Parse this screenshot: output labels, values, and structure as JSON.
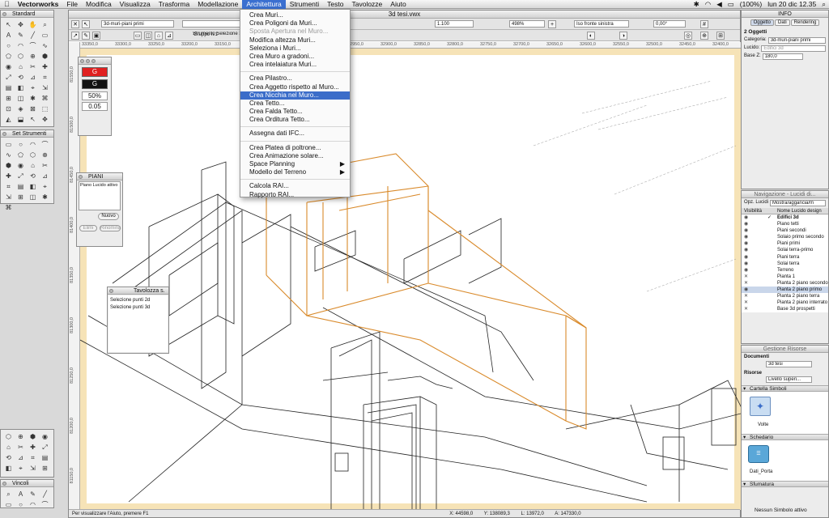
{
  "menubar": {
    "app": "Vectorworks",
    "items": [
      "File",
      "Modifica",
      "Visualizza",
      "Trasforma",
      "Modellazione",
      "Architettura",
      "Strumenti",
      "Testo",
      "Tavolozze",
      "Aiuto"
    ],
    "battery": "(100%)",
    "clock": "lun 20 dic  12.35"
  },
  "document": {
    "title": "3d tesi.vwx",
    "class_field": "3d-muri-piani primi",
    "layer_field": "Gruppo n.1",
    "scale_field": "1.100",
    "zoom_field": "498%",
    "view_field": "Iso fronte sinistra",
    "angle_field": "0,00°",
    "tool_hint": "Strumento Selezione 3D",
    "ruler_ticks": [
      "33350,0",
      "33300,0",
      "33250,0",
      "33200,0",
      "33150,0",
      "33100,0",
      "33050,0",
      "33000,0",
      "32950,0",
      "32900,0",
      "32850,0",
      "32800,0",
      "32750,0",
      "32700,0",
      "32650,0",
      "32600,0",
      "32550,0",
      "32500,0",
      "32450,0",
      "32400,0"
    ],
    "vruler_ticks": [
      "81550,0",
      "81500,0",
      "81450,0",
      "81400,0",
      "81350,0",
      "81300,0",
      "81250,0",
      "81200,0",
      "81150,0"
    ],
    "status": {
      "hint": "Per visualizzare l'Aiuto, premere F1",
      "x": "X: 44598,0",
      "y": "Y: 138089,3",
      "l": "L: 13972,0",
      "a": "A: 147330,0"
    }
  },
  "architettura_menu": {
    "items": [
      {
        "label": "Crea Muri...",
        "state": "normal"
      },
      {
        "label": "Crea Poligoni da Muri...",
        "state": "normal"
      },
      {
        "label": "Sposta Apertura nel Muro...",
        "state": "disabled"
      },
      {
        "label": "Modifica altezza Muri...",
        "state": "normal"
      },
      {
        "label": "Seleziona i Muri...",
        "state": "normal"
      },
      {
        "label": "Crea Muro a gradoni...",
        "state": "normal"
      },
      {
        "label": "Crea intelaiatura Muri...",
        "state": "normal"
      },
      {
        "sep": true
      },
      {
        "label": "Crea Pilastro...",
        "state": "normal"
      },
      {
        "label": "Crea Aggetto rispetto al Muro...",
        "state": "normal"
      },
      {
        "label": "Crea Nicchia nel Muro...",
        "state": "highlighted"
      },
      {
        "label": "Crea Tetto...",
        "state": "normal"
      },
      {
        "label": "Crea Falda Tetto...",
        "state": "normal"
      },
      {
        "label": "Crea Orditura Tetto...",
        "state": "normal"
      },
      {
        "sep": true
      },
      {
        "label": "Assegna dati IFC...",
        "state": "normal"
      },
      {
        "sep": true
      },
      {
        "label": "Crea Platea di poltrone...",
        "state": "normal"
      },
      {
        "label": "Crea Animazione solare...",
        "state": "normal"
      },
      {
        "label": "Space Planning",
        "state": "submenu"
      },
      {
        "label": "Modello del Terreno",
        "state": "submenu"
      },
      {
        "sep": true
      },
      {
        "label": "Calcola RAI...",
        "state": "normal"
      },
      {
        "label": "Rapporto RAI...",
        "state": "normal"
      }
    ]
  },
  "palettes": {
    "standard": "Standard",
    "set_strumenti": "Set Strumenti",
    "vincoli": "Vincoli",
    "attributes": {
      "opacity": "50%",
      "lineweight": "0.05"
    },
    "piani": {
      "title": "PIANI",
      "active_label": "Piano Lucido attivo",
      "new_button": "Nuovo",
      "btn_a": "Elimi",
      "btn_b": "Rinomina"
    },
    "tavolozza": {
      "title": "Tavolozza s.",
      "items": [
        "Selezione punti 2d",
        "Selezione punti 3d"
      ]
    }
  },
  "info": {
    "title": "INFO",
    "tabs": [
      "Oggetto",
      "Dati",
      "Rendering"
    ],
    "objects": "2 Oggetti",
    "categoria_label": "Categoria:",
    "categoria_value": "3d-muri-piani primi",
    "lucido_label": "Lucido:",
    "lucido_value": "Edifici 3d",
    "base_label": "Base Z:",
    "base_value": "180,0"
  },
  "navigazione": {
    "title": "Navigazione - Lucidi di...",
    "opz_label": "Opz. Lucidi",
    "opz_value": "Mostra/aggancia/m",
    "col_vis": "Visibilità",
    "col_name": "Nome Lucido design",
    "layers": [
      {
        "name": "Edifici 3d",
        "vis": "eye",
        "active": true
      },
      {
        "name": "Piano tetti",
        "vis": "eye",
        "active": false
      },
      {
        "name": "Piani secondi",
        "vis": "eye",
        "active": false
      },
      {
        "name": "Solaio primo secondo",
        "vis": "eye",
        "active": false
      },
      {
        "name": "Piani primi",
        "vis": "eye",
        "active": false
      },
      {
        "name": "Solai terra-primo",
        "vis": "eye",
        "active": false
      },
      {
        "name": "Piani terra",
        "vis": "eye",
        "active": false
      },
      {
        "name": "Solai terra",
        "vis": "eye",
        "active": false
      },
      {
        "name": "Terreno",
        "vis": "eye",
        "active": false
      },
      {
        "name": "Pianta 1",
        "vis": "x",
        "active": false
      },
      {
        "name": "Pianta 2 piano secondo",
        "vis": "x",
        "active": false
      },
      {
        "name": "Pianta 2 piano primo",
        "vis": "eye",
        "active": false,
        "selected": true
      },
      {
        "name": "Pianta 2 piano terra",
        "vis": "x",
        "active": false
      },
      {
        "name": "Pianta 2 piano interrato",
        "vis": "x",
        "active": false
      },
      {
        "name": "Base 3d prospetti",
        "vis": "x",
        "active": false
      }
    ]
  },
  "risorse": {
    "title": "Gestione Risorse",
    "documenti_label": "Documenti",
    "documenti_value": "3d tesi",
    "risorse_label": "Risorse",
    "livello_value": "Livello superi...",
    "sections": [
      {
        "name": "Cartella Simboli",
        "item": "Volte"
      },
      {
        "name": "Schedario",
        "item": "Dati_Porta"
      },
      {
        "name": "Sfumatura",
        "item": ""
      }
    ],
    "footer": "Nessun Simbolo attivo"
  },
  "colors": {
    "accent": "#3b6dc9",
    "highlight_walls": "#d98a2b",
    "canvas_border": "#f6e3b7"
  },
  "icons": [
    "apple-icon",
    "arrow-tool-icon",
    "flyover-icon",
    "wifi-icon",
    "battery-icon",
    "search-icon"
  ]
}
